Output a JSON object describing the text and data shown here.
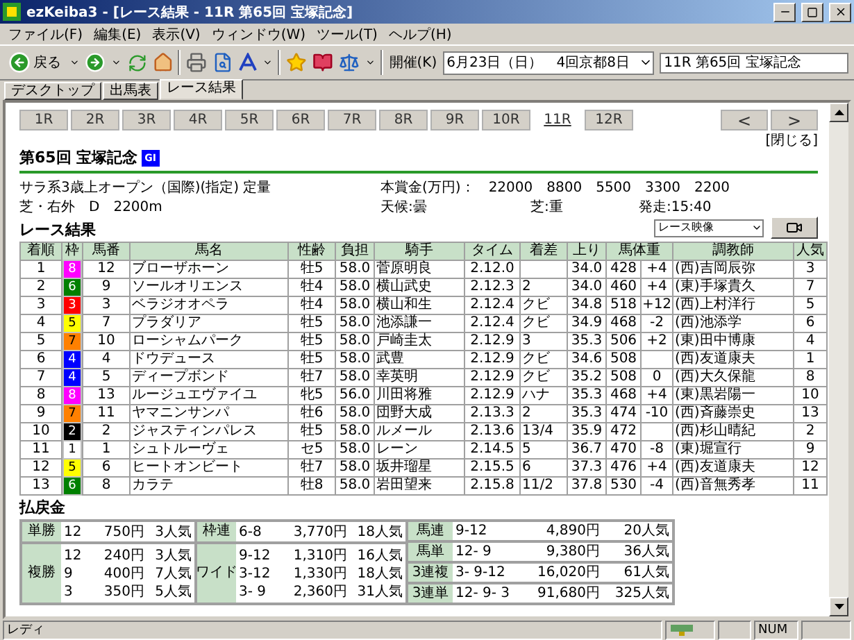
{
  "window": {
    "title": "ezKeiba3 - [レース結果 - 11R 第65回 宝塚記念]"
  },
  "menu": [
    "ファイル(F)",
    "編集(E)",
    "表示(V)",
    "ウィンドウ(W)",
    "ツール(T)",
    "ヘルプ(H)"
  ],
  "toolbar": {
    "back_label": "戻る",
    "meeting_label": "開催(K)",
    "meeting_value": "6月23日（日）　4回京都8日",
    "race_value": "11R 第65回 宝塚記念"
  },
  "tabs": [
    {
      "label": "デスクトップ",
      "selected": false
    },
    {
      "label": "出馬表",
      "selected": false
    },
    {
      "label": "レース結果",
      "selected": true
    }
  ],
  "races": [
    {
      "label": "1R",
      "selected": false
    },
    {
      "label": "2R",
      "selected": false
    },
    {
      "label": "3R",
      "selected": false
    },
    {
      "label": "4R",
      "selected": false
    },
    {
      "label": "5R",
      "selected": false
    },
    {
      "label": "6R",
      "selected": false
    },
    {
      "label": "7R",
      "selected": false
    },
    {
      "label": "8R",
      "selected": false
    },
    {
      "label": "9R",
      "selected": false
    },
    {
      "label": "10R",
      "selected": false
    },
    {
      "label": "11R",
      "selected": true
    },
    {
      "label": "12R",
      "selected": false
    }
  ],
  "nav": [
    "<",
    ">"
  ],
  "close_link": "[閉じる]",
  "race": {
    "title": "第65回 宝塚記念",
    "grade": "GI",
    "condition": "サラ系3歳上オープン（国際)(指定) 定量",
    "course": "芝・右外　D　2200m",
    "prize_label": "本賞金(万円)：",
    "prizes": [
      "22000",
      "8800",
      "5500",
      "3300",
      "2200"
    ],
    "weather": "天候:曇",
    "going": "芝:重",
    "start": "発走:15:40",
    "video_select": "レース映像"
  },
  "results_title": "レース結果",
  "table": {
    "columns": [
      "着順",
      "枠",
      "馬番",
      "馬名",
      "性齢",
      "負担",
      "騎手",
      "タイム",
      "着差",
      "上り",
      "馬体重",
      "調教師",
      "人気"
    ],
    "rows": [
      {
        "cells": [
          "1",
          "8",
          "12",
          "ブローザホーン",
          "牡5",
          "58.0",
          "菅原明良",
          "2.12.0",
          "",
          "34.0",
          [
            "428",
            "+4"
          ],
          "(西)吉岡辰弥",
          "3"
        ],
        "color": "#ff00ff"
      },
      {
        "cells": [
          "2",
          "6",
          "9",
          "ソールオリエンス",
          "牡4",
          "58.0",
          "横山武史",
          "2.12.3",
          "2",
          "34.0",
          [
            "460",
            "+4"
          ],
          "(東)手塚貴久",
          "7"
        ],
        "color": "#008000"
      },
      {
        "cells": [
          "3",
          "3",
          "3",
          "ベラジオオペラ",
          "牡4",
          "58.0",
          "横山和生",
          "2.12.4",
          "クビ",
          "34.8",
          [
            "518",
            "+12"
          ],
          "(西)上村洋行",
          "5"
        ],
        "color": "#ff0000"
      },
      {
        "cells": [
          "4",
          "5",
          "7",
          "プラダリア",
          "牡5",
          "58.0",
          "池添謙一",
          "2.12.4",
          "クビ",
          "34.9",
          [
            "468",
            "-2"
          ],
          "(西)池添学",
          "6"
        ],
        "color": "#ffff00"
      },
      {
        "cells": [
          "5",
          "7",
          "10",
          "ローシャムパーク",
          "牡5",
          "58.0",
          "戸崎圭太",
          "2.12.9",
          "3",
          "35.3",
          [
            "506",
            "+2"
          ],
          "(東)田中博康",
          "4"
        ],
        "color": "#ff8000"
      },
      {
        "cells": [
          "6",
          "4",
          "4",
          "ドウデュース",
          "牡5",
          "58.0",
          "武豊",
          "2.12.9",
          "クビ",
          "34.6",
          [
            "508"
          ],
          "(西)友道康夫",
          "1"
        ],
        "color": "#0000ff"
      },
      {
        "cells": [
          "7",
          "4",
          "5",
          "ディープボンド",
          "牡7",
          "58.0",
          "幸英明",
          "2.12.9",
          "クビ",
          "35.2",
          [
            "508",
            "0"
          ],
          "(西)大久保龍",
          "8"
        ],
        "color": "#0000ff"
      },
      {
        "cells": [
          "8",
          "8",
          "13",
          "ルージュエヴァイユ",
          "牝5",
          "56.0",
          "川田将雅",
          "2.12.9",
          "ハナ",
          "35.3",
          [
            "468",
            "+4"
          ],
          "(東)黒岩陽一",
          "10"
        ],
        "color": "#ff00ff"
      },
      {
        "cells": [
          "9",
          "7",
          "11",
          "ヤマニンサンパ",
          "牡6",
          "58.0",
          "団野大成",
          "2.13.3",
          "2",
          "35.3",
          [
            "474",
            "-10"
          ],
          "(西)斉藤崇史",
          "13"
        ],
        "color": "#ff8000"
      },
      {
        "cells": [
          "10",
          "2",
          "2",
          "ジャスティンパレス",
          "牡5",
          "58.0",
          "ルメール",
          "2.13.6",
          "13/4",
          "35.9",
          [
            "472"
          ],
          "(西)杉山晴紀",
          "2"
        ],
        "color": "#000000"
      },
      {
        "cells": [
          "11",
          "1",
          "1",
          "シュトルーヴェ",
          "セ5",
          "58.0",
          "レーン",
          "2.14.5",
          "5",
          "36.7",
          [
            "470",
            "-8"
          ],
          "(東)堀宣行",
          "9"
        ],
        "color": "#ffffff"
      },
      {
        "cells": [
          "12",
          "5",
          "6",
          "ヒートオンビート",
          "牡7",
          "58.0",
          "坂井瑠星",
          "2.15.5",
          "6",
          "37.3",
          [
            "476",
            "+4"
          ],
          "(西)友道康夫",
          "12"
        ],
        "color": "#ffff00"
      },
      {
        "cells": [
          "13",
          "6",
          "8",
          "カラテ",
          "牡8",
          "58.0",
          "岩田望来",
          "2.15.8",
          "11/2",
          "37.8",
          [
            "530",
            "-4"
          ],
          "(西)音無秀孝",
          "11"
        ],
        "color": "#008000"
      }
    ]
  },
  "payout_title": "払戻金",
  "payouts": [
    [
      {
        "type": "単勝",
        "lines": [
          [
            "12",
            "750円",
            "3人気"
          ]
        ]
      },
      {
        "type": "複勝",
        "lines": [
          [
            "12",
            "240円",
            "3人気"
          ],
          [
            "9",
            "400円",
            "7人気"
          ],
          [
            "3",
            "350円",
            "5人気"
          ]
        ]
      }
    ],
    [
      {
        "type": "枠連",
        "lines": [
          [
            "6-8",
            "3,770円",
            "18人気"
          ]
        ]
      },
      {
        "type": "ワイド",
        "lines": [
          [
            "9-12",
            "1,310円",
            "16人気"
          ],
          [
            "3-12",
            "1,330円",
            "18人気"
          ],
          [
            "3- 9",
            "2,360円",
            "31人気"
          ]
        ]
      }
    ],
    [
      {
        "type": "馬連",
        "lines": [
          [
            "9-12",
            "4,890円",
            "20人気"
          ]
        ]
      },
      {
        "type": "馬単",
        "lines": [
          [
            "12- 9",
            "9,380円",
            "36人気"
          ]
        ]
      },
      {
        "type": "3連複",
        "lines": [
          [
            "3- 9-12",
            "16,020円",
            "61人気"
          ]
        ]
      },
      {
        "type": "3連単",
        "lines": [
          [
            "12- 9- 3",
            "91,680円",
            "325人気"
          ]
        ]
      }
    ]
  ],
  "status_bar": {
    "text": "レディ",
    "num": "NUM"
  }
}
